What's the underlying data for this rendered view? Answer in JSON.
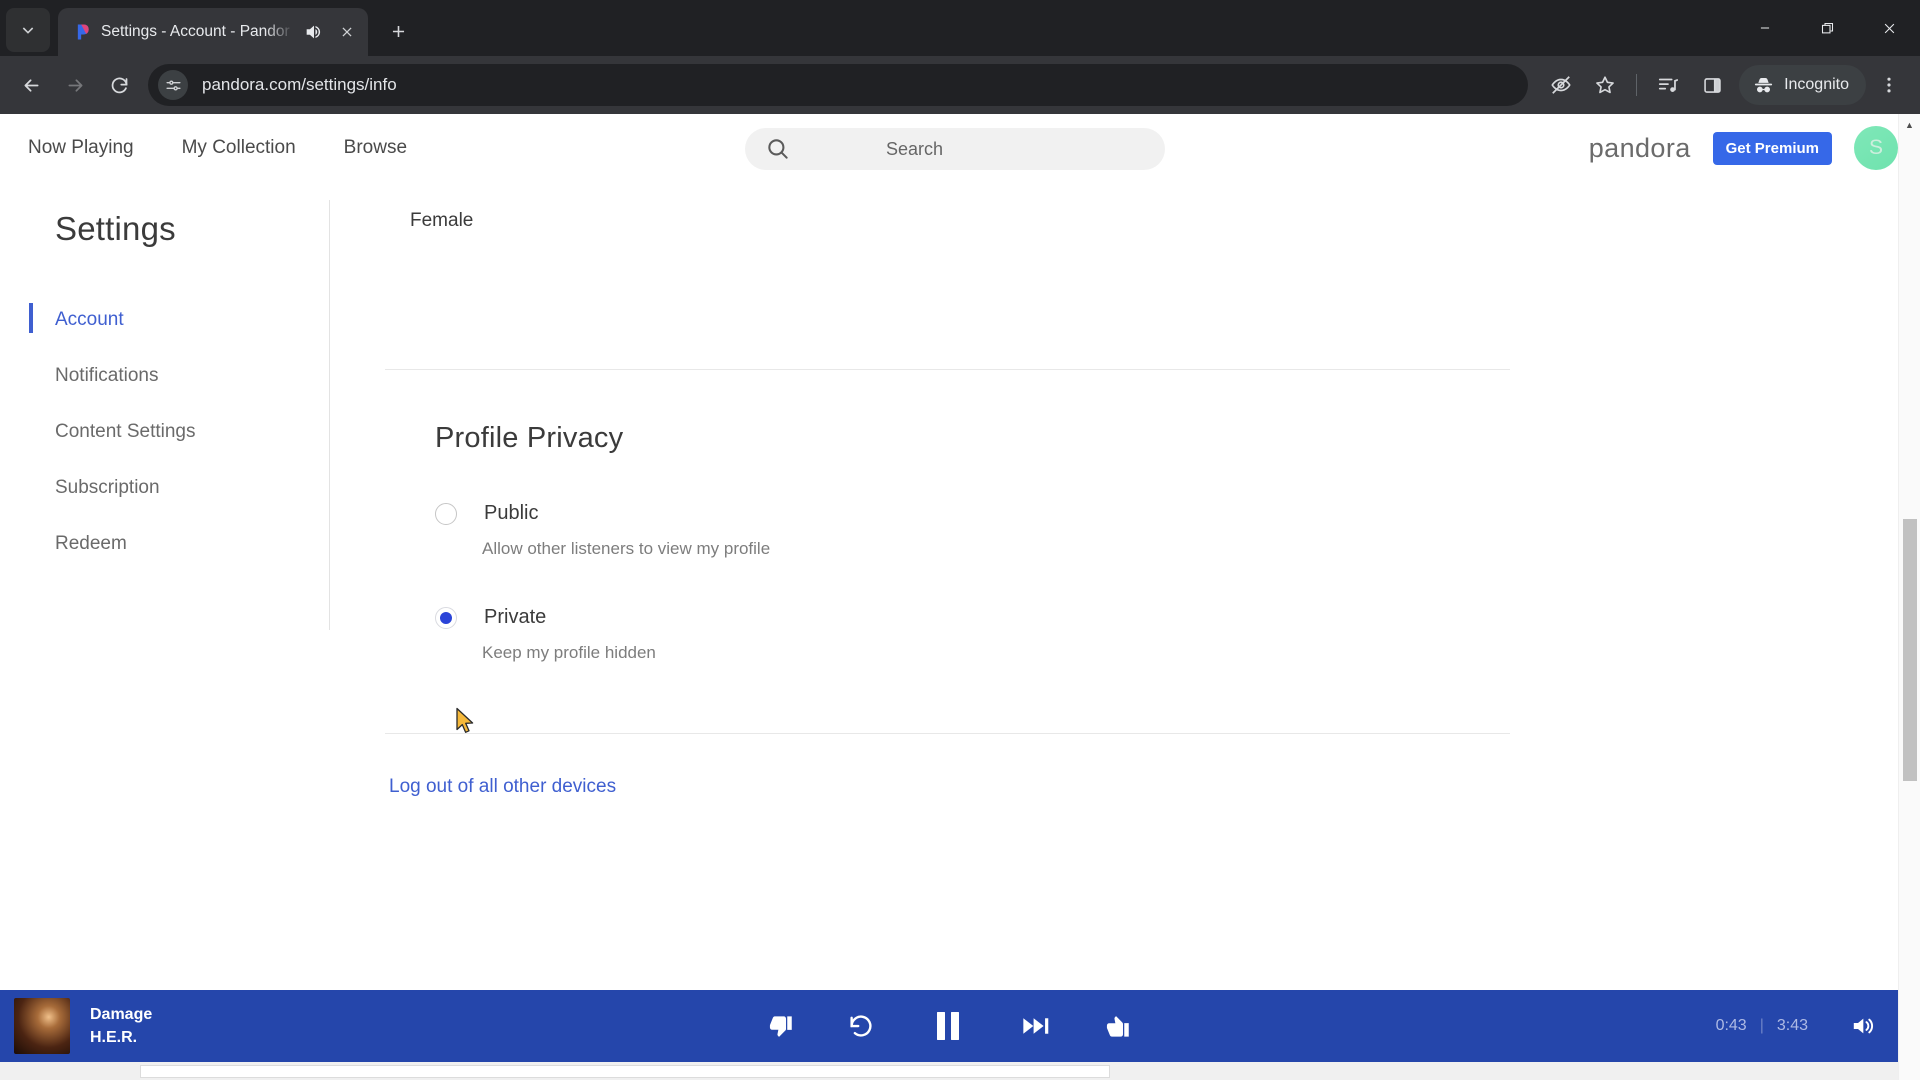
{
  "browser": {
    "tab": {
      "title": "Settings - Account - Pandor",
      "favicon_name": "pandora-favicon",
      "audio_icon": "speaker-playing-icon",
      "close_icon": "close-icon"
    },
    "new_tab_label": "+",
    "tab_list_icon": "chevron-down-icon",
    "window_controls": {
      "minimize": "minimize-icon",
      "maximize": "restore-icon",
      "close": "close-icon"
    },
    "nav": {
      "back_icon": "back-arrow-icon",
      "forward_icon": "forward-arrow-icon",
      "reload_icon": "reload-icon"
    },
    "omnibox": {
      "url": "pandora.com/settings/info",
      "site_info_icon": "site-settings-icon"
    },
    "toolbar_right": {
      "tracking_protection_icon": "eye-slash-icon",
      "bookmark_icon": "star-icon",
      "media_icon": "media-list-icon",
      "side_panel_icon": "side-panel-icon",
      "incognito_label": "Incognito",
      "incognito_icon": "incognito-hat-icon",
      "menu_icon": "three-dot-menu-icon"
    }
  },
  "page": {
    "nav": {
      "links": [
        {
          "label": "Now Playing"
        },
        {
          "label": "My Collection"
        },
        {
          "label": "Browse"
        }
      ],
      "search": {
        "placeholder": "Search",
        "icon": "search-icon"
      },
      "logo_text": "pandora",
      "premium_button": "Get Premium",
      "avatar_initial": "S",
      "avatar_color": "#74e4af",
      "premium_color": "#3668e8"
    },
    "sidebar": {
      "title": "Settings",
      "items": [
        {
          "label": "Account",
          "active": true
        },
        {
          "label": "Notifications",
          "active": false
        },
        {
          "label": "Content Settings",
          "active": false
        },
        {
          "label": "Subscription",
          "active": false
        },
        {
          "label": "Redeem",
          "active": false
        }
      ],
      "active_color": "#3f5fd0"
    },
    "content": {
      "gender_value": "Female",
      "privacy_section_title": "Profile Privacy",
      "options": [
        {
          "label": "Public",
          "description": "Allow other listeners to view my profile",
          "selected": false
        },
        {
          "label": "Private",
          "description": "Keep my profile hidden",
          "selected": true
        }
      ],
      "logout_link": "Log out of all other devices",
      "radio_selected_color": "#2b44d8"
    }
  },
  "player": {
    "track_title": "Damage",
    "track_artist": "H.E.R.",
    "elapsed_time": "0:43",
    "total_time": "3:43",
    "time_separator": "|",
    "background_color": "#2546ab",
    "controls": {
      "thumbs_down_icon": "thumbs-down-icon",
      "replay_icon": "replay-icon",
      "pause_icon": "pause-icon",
      "skip_icon": "skip-next-icon",
      "thumbs_up_icon": "thumbs-up-icon",
      "volume_icon": "volume-on-icon"
    }
  }
}
